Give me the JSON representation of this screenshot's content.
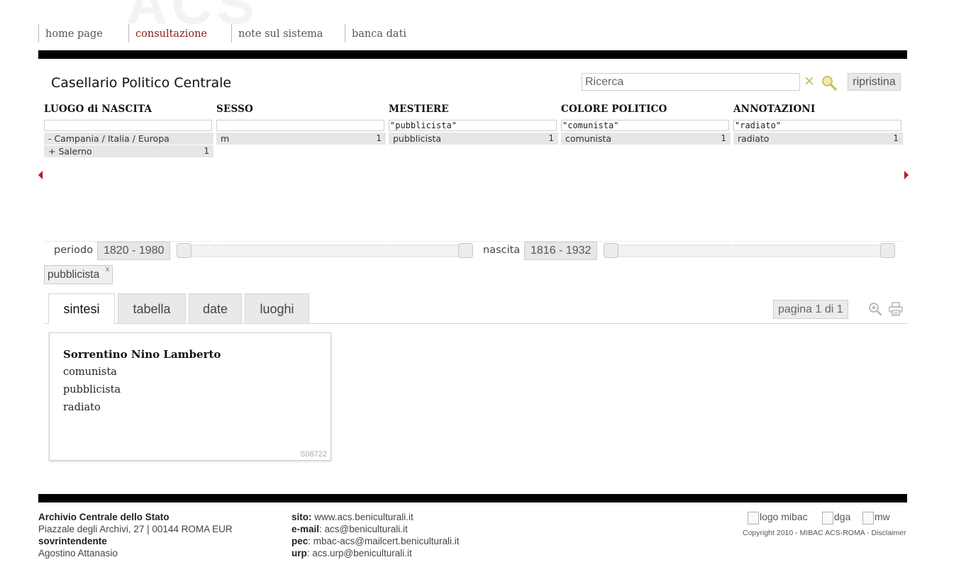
{
  "nav": {
    "items": [
      {
        "label": "home page"
      },
      {
        "label": "consultazione"
      },
      {
        "label": "note sul sistema"
      },
      {
        "label": "banca dati"
      }
    ]
  },
  "header": {
    "title": "Casellario Politico Centrale",
    "search_placeholder": "Ricerca",
    "clear_symbol": "✕",
    "reset_label": "ripristina"
  },
  "facets": [
    {
      "title": "LUOGO di NASCITA",
      "filter": "",
      "rows": [
        {
          "label": "- Campania / Italia / Europa",
          "count": ""
        },
        {
          "label": "+ Salerno",
          "count": "1"
        }
      ]
    },
    {
      "title": "SESSO",
      "filter": "",
      "rows": [
        {
          "label": "m",
          "count": "1"
        }
      ]
    },
    {
      "title": "MESTIERE",
      "filter": "\"pubblicista\"",
      "rows": [
        {
          "label": "pubblicista",
          "count": "1"
        }
      ]
    },
    {
      "title": "COLORE POLITICO",
      "filter": "\"comunista\"",
      "rows": [
        {
          "label": "comunista",
          "count": "1"
        }
      ]
    },
    {
      "title": "ANNOTAZIONI",
      "filter": "\"radiato\"",
      "rows": [
        {
          "label": "radiato",
          "count": "1"
        }
      ]
    }
  ],
  "sliders": {
    "periodo": {
      "label": "periodo",
      "range": "1820 - 1980"
    },
    "nascita": {
      "label": "nascita",
      "range": "1816 - 1932"
    }
  },
  "active_filter": {
    "label": "pubblicista",
    "remove": "x"
  },
  "tabs": [
    {
      "label": "sintesi",
      "active": true
    },
    {
      "label": "tabella"
    },
    {
      "label": "date"
    },
    {
      "label": "luoghi"
    }
  ],
  "pagination": {
    "label": "pagina 1 di 1"
  },
  "record": {
    "name": "Sorrentino Nino Lamberto",
    "lines": [
      "comunista",
      "pubblicista",
      "radiato"
    ],
    "id": "S08722"
  },
  "footer": {
    "org": "Archivio Centrale dello Stato",
    "address": "Piazzale degli Archivi, 27 | 00144 ROMA EUR",
    "role": "sovrintendente",
    "person": "Agostino Attanasio",
    "site_key": "sito:",
    "site_val": " www.acs.beniculturali.it",
    "email_key": "e-mail",
    "email_val": ": acs@beniculturali.it",
    "pec_key": "pec",
    "pec_val": ": mbac-acs@mailcert.beniculturali.it",
    "urp_key": "urp",
    "urp_val": ": acs.urp@beniculturali.it",
    "logos": [
      "logo mibac",
      "dga",
      "mw"
    ],
    "copyright": "Copyright 2010 - MIBAC ACS-ROMA - Disclaimer"
  },
  "colors": {
    "accent": "#8a1c12",
    "arrow": "#c0141a",
    "bar": "#000000"
  }
}
